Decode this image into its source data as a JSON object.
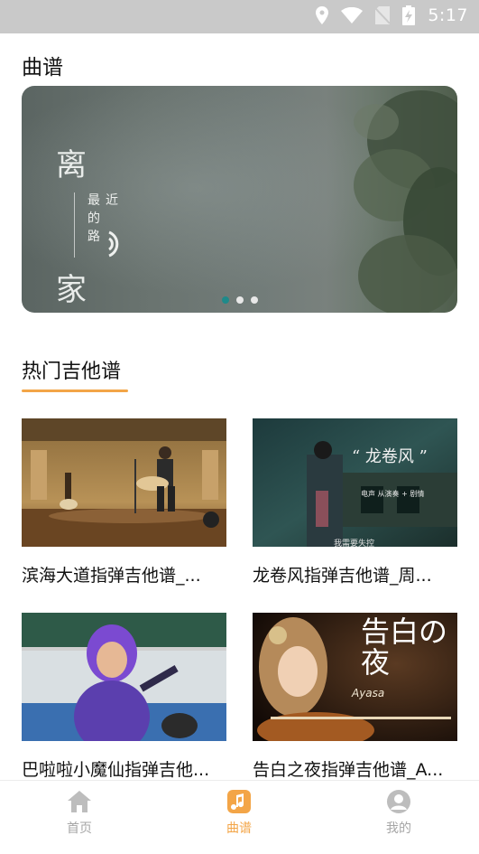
{
  "status_bar": {
    "time": "5:17"
  },
  "page_title": "曲谱",
  "banner": {
    "big_chars": [
      "离",
      "家"
    ],
    "small_col_left": "最的路",
    "small_col_right": "近",
    "active_dot": 0,
    "dot_count": 3
  },
  "section_title": "热门吉他谱",
  "cards": [
    {
      "caption": "滨海大道指弹吉他谱_..."
    },
    {
      "caption": "龙卷风指弹吉他谱_周...",
      "overlay_title": "“ 龙卷风 ”",
      "overlay_sub": "电声 从演奏 + 剧情",
      "overlay_bottom": "我需要失控"
    },
    {
      "caption": "巴啦啦小魔仙指弹吉他..."
    },
    {
      "caption": "告白之夜指弹吉他谱_A...",
      "overlay_title": "告白の夜",
      "overlay_sub": "Ayasa"
    }
  ],
  "tabs": [
    {
      "label": "首页",
      "icon": "home-icon",
      "active": false
    },
    {
      "label": "曲谱",
      "icon": "music-note-icon",
      "active": true
    },
    {
      "label": "我的",
      "icon": "user-icon",
      "active": false
    }
  ],
  "colors": {
    "accent": "#f3a547",
    "status_bar": "#c9c9c9",
    "dot_active": "#1f8a8a"
  }
}
